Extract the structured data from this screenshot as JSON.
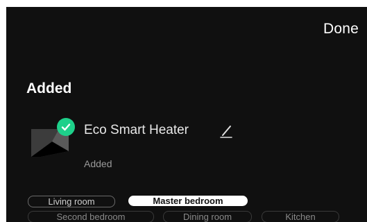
{
  "header": {
    "done_label": "Done"
  },
  "section": {
    "title": "Added"
  },
  "device": {
    "name": "Eco Smart Heater",
    "status": "Added",
    "thumbnail_icon": "heater-icon",
    "check_icon": "check-icon",
    "edit_icon": "pencil-icon"
  },
  "rooms": {
    "items": [
      {
        "label": "Living room",
        "selected": false
      },
      {
        "label": "Master bedroom",
        "selected": true
      },
      {
        "label": "Second bedroom",
        "selected": false
      },
      {
        "label": "Dining room",
        "selected": false
      },
      {
        "label": "Kitchen",
        "selected": false
      }
    ]
  },
  "colors": {
    "background": "#101010",
    "accent_green": "#1ed08a",
    "selected_chip": "#ffffff"
  }
}
